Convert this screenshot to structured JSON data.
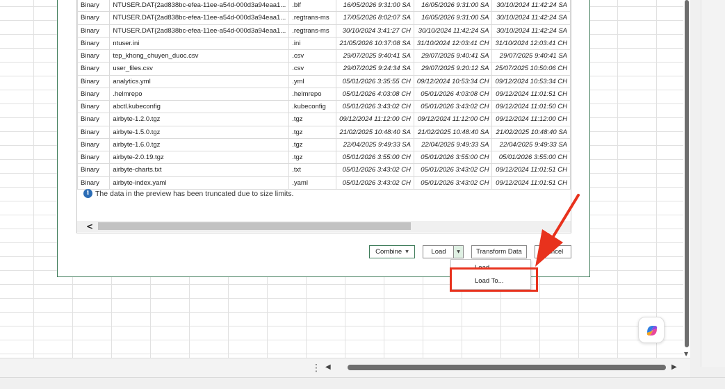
{
  "preview_table": {
    "rows": [
      {
        "type": "Binary",
        "name": "NTUSER.DAT{2ad838bc-efea-11ee-a54d-000d3a94eaa1...",
        "ext": ".blf",
        "accessed": "16/05/2026 9:31:00 SA",
        "modified": "16/05/2026 9:31:00 SA",
        "created": "30/10/2024 11:42:24 SA"
      },
      {
        "type": "Binary",
        "name": "NTUSER.DAT{2ad838bc-efea-11ee-a54d-000d3a94eaa1...",
        "ext": ".regtrans-ms",
        "accessed": "17/05/2026 8:02:07 SA",
        "modified": "16/05/2026 9:31:00 SA",
        "created": "30/10/2024 11:42:24 SA"
      },
      {
        "type": "Binary",
        "name": "NTUSER.DAT{2ad838bc-efea-11ee-a54d-000d3a94eaa1...",
        "ext": ".regtrans-ms",
        "accessed": "30/10/2024 3:41:27 CH",
        "modified": "30/10/2024 11:42:24 SA",
        "created": "30/10/2024 11:42:24 SA"
      },
      {
        "type": "Binary",
        "name": "ntuser.ini",
        "ext": ".ini",
        "accessed": "21/05/2026 10:37:08 SA",
        "modified": "31/10/2024 12:03:41 CH",
        "created": "31/10/2024 12:03:41 CH"
      },
      {
        "type": "Binary",
        "name": "tep_khong_chuyen_duoc.csv",
        "ext": ".csv",
        "accessed": "29/07/2025 9:40:41 SA",
        "modified": "29/07/2025 9:40:41 SA",
        "created": "29/07/2025 9:40:41 SA"
      },
      {
        "type": "Binary",
        "name": "user_files.csv",
        "ext": ".csv",
        "accessed": "29/07/2025 9:24:34 SA",
        "modified": "29/07/2025 9:20:12 SA",
        "created": "25/07/2025 10:50:06 CH"
      },
      {
        "type": "Binary",
        "name": "analytics.yml",
        "ext": ".yml",
        "accessed": "05/01/2026 3:35:55 CH",
        "modified": "09/12/2024 10:53:34 CH",
        "created": "09/12/2024 10:53:34 CH"
      },
      {
        "type": "Binary",
        "name": ".helmrepo",
        "ext": ".helmrepo",
        "accessed": "05/01/2026 4:03:08 CH",
        "modified": "05/01/2026 4:03:08 CH",
        "created": "09/12/2024 11:01:51 CH"
      },
      {
        "type": "Binary",
        "name": "abctl.kubeconfig",
        "ext": ".kubeconfig",
        "accessed": "05/01/2026 3:43:02 CH",
        "modified": "05/01/2026 3:43:02 CH",
        "created": "09/12/2024 11:01:50 CH"
      },
      {
        "type": "Binary",
        "name": "airbyte-1.2.0.tgz",
        "ext": ".tgz",
        "accessed": "09/12/2024 11:12:00 CH",
        "modified": "09/12/2024 11:12:00 CH",
        "created": "09/12/2024 11:12:00 CH"
      },
      {
        "type": "Binary",
        "name": "airbyte-1.5.0.tgz",
        "ext": ".tgz",
        "accessed": "21/02/2025 10:48:40 SA",
        "modified": "21/02/2025 10:48:40 SA",
        "created": "21/02/2025 10:48:40 SA"
      },
      {
        "type": "Binary",
        "name": "airbyte-1.6.0.tgz",
        "ext": ".tgz",
        "accessed": "22/04/2025 9:49:33 SA",
        "modified": "22/04/2025 9:49:33 SA",
        "created": "22/04/2025 9:49:33 SA"
      },
      {
        "type": "Binary",
        "name": "airbyte-2.0.19.tgz",
        "ext": ".tgz",
        "accessed": "05/01/2026 3:55:00 CH",
        "modified": "05/01/2026 3:55:00 CH",
        "created": "05/01/2026 3:55:00 CH"
      },
      {
        "type": "Binary",
        "name": "airbyte-charts.txt",
        "ext": ".txt",
        "accessed": "05/01/2026 3:43:02 CH",
        "modified": "05/01/2026 3:43:02 CH",
        "created": "09/12/2024 11:01:51 CH"
      },
      {
        "type": "Binary",
        "name": "airbyte-index.yaml",
        "ext": ".yaml",
        "accessed": "05/01/2026 3:43:02 CH",
        "modified": "05/01/2026 3:43:02 CH",
        "created": "09/12/2024 11:01:51 CH"
      }
    ]
  },
  "notice": {
    "icon": "info-icon",
    "glyph": "i",
    "text": "The data in the preview has been truncated due to size limits."
  },
  "buttons": {
    "combine": "Combine",
    "load": "Load",
    "transform": "Transform Data",
    "cancel": "Cancel"
  },
  "load_menu": {
    "items": [
      "Load",
      "Load To..."
    ]
  },
  "colors": {
    "annotation_red": "#e8321d",
    "dialog_border": "#3f7c5a",
    "copilot_icon": "copilot-icon"
  }
}
